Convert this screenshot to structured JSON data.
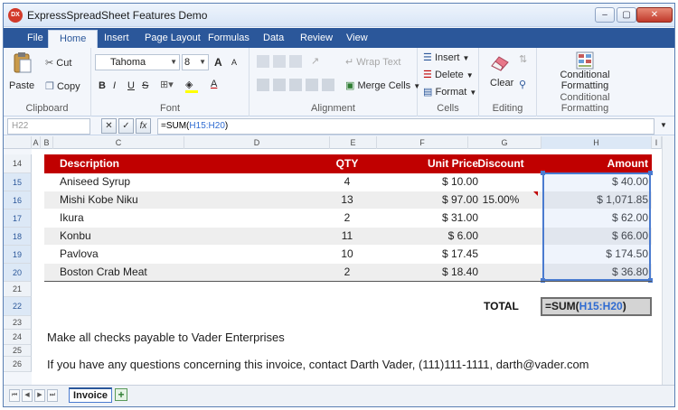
{
  "window": {
    "title": "ExpressSpreadSheet Features Demo",
    "logo_text": "DX"
  },
  "window_controls": {
    "minimize": "–",
    "maximize": "▢",
    "close": "✕"
  },
  "tabs": [
    "File",
    "Home",
    "Insert",
    "Page Layout",
    "Formulas",
    "Data",
    "Review",
    "View"
  ],
  "ribbon": {
    "clipboard": {
      "paste": "Paste",
      "cut": "Cut",
      "copy": "Copy",
      "label": "Clipboard"
    },
    "font": {
      "name": "Tahoma",
      "size": "8",
      "bold": "B",
      "italic": "I",
      "underline": "U",
      "strike": "S",
      "grow": "A",
      "shrink": "A",
      "font_color": "A",
      "label": "Font"
    },
    "alignment": {
      "wrap": "Wrap Text",
      "merge": "Merge Cells",
      "label": "Alignment"
    },
    "cells": {
      "insert": "Insert",
      "delete": "Delete",
      "format": "Format",
      "label": "Cells"
    },
    "editing": {
      "clear": "Clear",
      "label": "Editing"
    },
    "styles": {
      "conditional": "Conditional",
      "formatting": "Formatting",
      "label": "Conditional Formatting"
    }
  },
  "formula_bar": {
    "name_box": "H22",
    "cancel": "✕",
    "enter": "✓",
    "fx": "fx",
    "formula_prefix": "=SUM(",
    "formula_ref": "H15:H20",
    "formula_suffix": ")"
  },
  "columns": [
    "A",
    "B",
    "C",
    "D",
    "E",
    "F",
    "G",
    "H",
    "I"
  ],
  "rows": [
    "14",
    "15",
    "16",
    "17",
    "18",
    "19",
    "20",
    "21",
    "22",
    "23",
    "24",
    "25",
    "26"
  ],
  "table": {
    "headers": {
      "description": "Description",
      "qty": "QTY",
      "unit_price": "Unit Price",
      "discount": "Discount",
      "amount": "Amount"
    },
    "items": [
      {
        "description": "Aniseed Syrup",
        "qty": "4",
        "unit_price": "$ 10.00",
        "discount": "",
        "amount": "$ 40.00"
      },
      {
        "description": "Mishi Kobe Niku",
        "qty": "13",
        "unit_price": "$ 97.00",
        "discount": "15.00%",
        "amount": "$ 1,071.85"
      },
      {
        "description": "Ikura",
        "qty": "2",
        "unit_price": "$ 31.00",
        "discount": "",
        "amount": "$ 62.00"
      },
      {
        "description": "Konbu",
        "qty": "11",
        "unit_price": "$ 6.00",
        "discount": "",
        "amount": "$ 66.00"
      },
      {
        "description": "Pavlova",
        "qty": "10",
        "unit_price": "$ 17.45",
        "discount": "",
        "amount": "$ 174.50"
      },
      {
        "description": "Boston Crab Meat",
        "qty": "2",
        "unit_price": "$ 18.40",
        "discount": "",
        "amount": "$ 36.80"
      }
    ],
    "total_label": "TOTAL",
    "total_prefix": "=SUM(",
    "total_ref": "H15:H20",
    "total_suffix": ")"
  },
  "notes": {
    "payable": "Make all checks payable to Vader Enterprises",
    "contact": "If you have any questions concerning this invoice, contact Darth Vader, (111)111-1111, darth@vader.com"
  },
  "sheet_tabs": {
    "active": "Invoice",
    "add": "+"
  },
  "colors": {
    "header_band": "#c00000",
    "tab_bar": "#2b579a",
    "selection": "#4a7bd0"
  }
}
